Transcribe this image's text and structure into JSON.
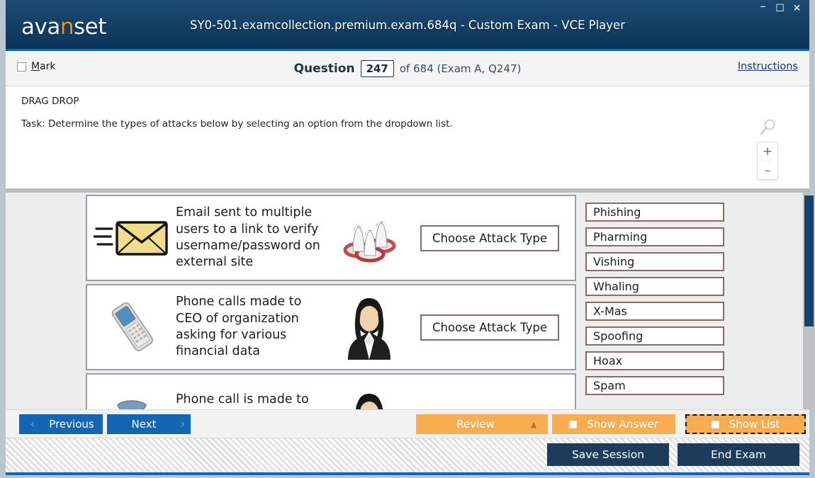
{
  "window": {
    "logo_prefix": "ava",
    "logo_accent": "n",
    "logo_suffix": "set",
    "title": "SY0-501.examcollection.premium.exam.684q - Custom Exam - VCE Player",
    "controls": {
      "minimize": "–",
      "maximize": "☐",
      "close": "✕"
    }
  },
  "question_bar": {
    "mark_label_accel": "M",
    "mark_label_rest": "ark",
    "question_word": "Question",
    "question_number": "247",
    "question_total": "of 684 (Exam A, Q247)",
    "instructions": "Instructions"
  },
  "question_panel": {
    "type_label": "DRAG DROP",
    "task_text": "Task: Determine the types of attacks below by selecting an option from the dropdown list.",
    "zoom_in": "+",
    "zoom_out": "–"
  },
  "content": {
    "cards": [
      {
        "icon": "email-envelope-icon",
        "text": "Email sent to multiple users to a link to verify username/password on external site",
        "avatar": "group-of-users-icon",
        "dropdown_label": "Choose Attack Type"
      },
      {
        "icon": "mobile-phone-icon",
        "text": "Phone calls made to CEO of organization asking for various financial data",
        "avatar": "businesswoman-icon",
        "dropdown_label": "Choose Attack Type"
      },
      {
        "icon": "telephone-icon",
        "text": "Phone call is made to individual stating there was",
        "avatar": "woman-icon",
        "dropdown_label": ""
      }
    ],
    "options": [
      "Phishing",
      "Pharming",
      "Vishing",
      "Whaling",
      "X-Mas",
      "Spoofing",
      "Hoax",
      "Spam"
    ]
  },
  "toolbar": {
    "previous": "Previous",
    "next": "Next",
    "prev_chevron": "‹",
    "next_chevron": "›",
    "review": "Review",
    "review_caret": "▲",
    "show_answer": "Show Answer",
    "show_list": "Show List"
  },
  "footer": {
    "save_session": "Save Session",
    "end_exam": "End Exam"
  },
  "colors": {
    "titlebar": "#144167",
    "accent_blue": "#1266b2",
    "orange": "#f9ad51",
    "dark_navy": "#1d3c5c",
    "logo_accent": "#f0921e"
  }
}
